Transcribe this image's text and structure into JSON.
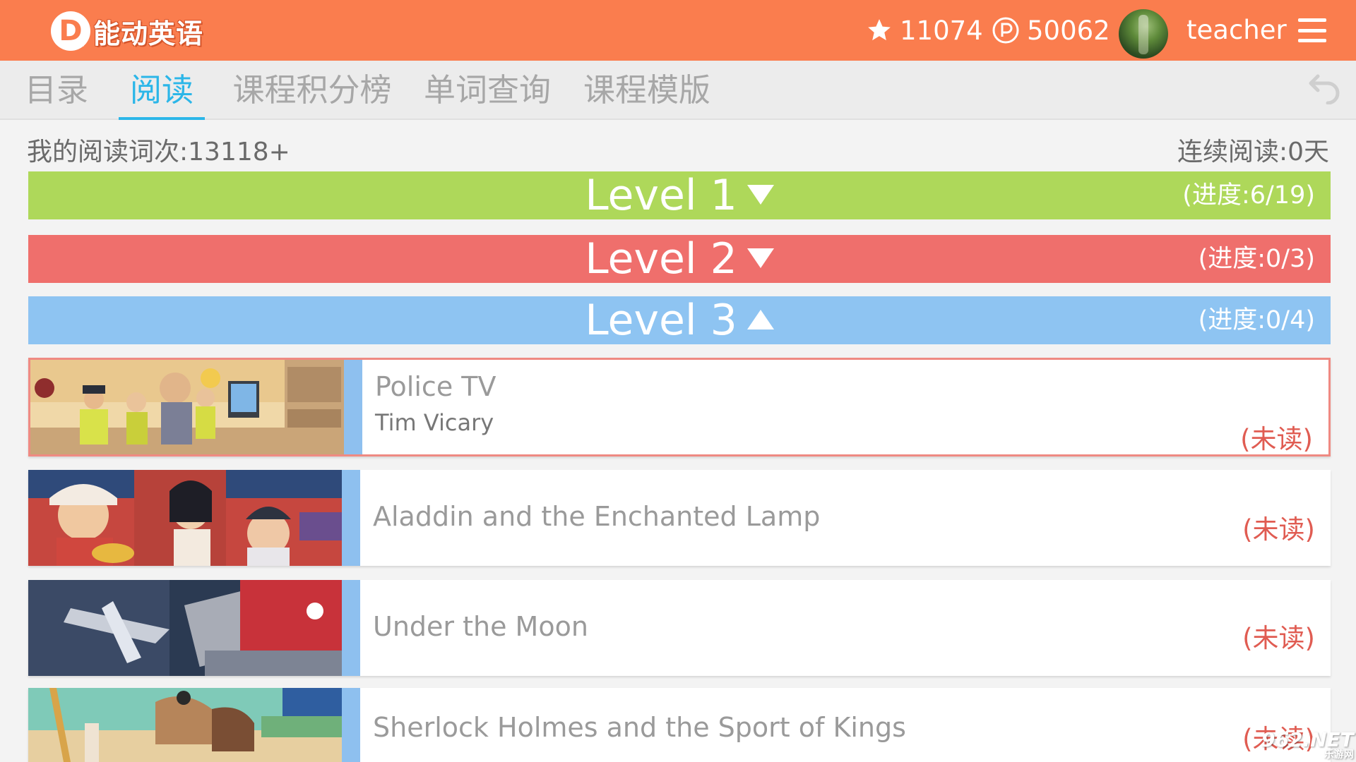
{
  "header": {
    "logo_letter": "D",
    "logo_text": "能动英语",
    "stars": "11074",
    "points": "50062",
    "username": "teacher",
    "icons": {
      "stars": "star-icon",
      "points": "points-coin-icon",
      "menu": "hamburger-menu-icon"
    }
  },
  "tabs": [
    {
      "label": "目录",
      "active": false
    },
    {
      "label": "阅读",
      "active": true
    },
    {
      "label": "课程积分榜",
      "active": false
    },
    {
      "label": "单词查询",
      "active": false
    },
    {
      "label": "课程模版",
      "active": false
    }
  ],
  "summary": {
    "read_count": "我的阅读词次:13118+",
    "streak": "连续阅读:0天"
  },
  "levels": [
    {
      "title": "Level 1",
      "expanded": false,
      "progress": "(进度:6/19)",
      "color": "#aed85a"
    },
    {
      "title": "Level 2",
      "expanded": false,
      "progress": "(进度:0/3)",
      "color": "#ef6f6c"
    },
    {
      "title": "Level 3",
      "expanded": true,
      "progress": "(进度:0/4)",
      "color": "#8ec4f2"
    }
  ],
  "books": [
    {
      "title": "Police TV",
      "author": "Tim Vicary",
      "status": "(未读)"
    },
    {
      "title": "Aladdin and the Enchanted Lamp",
      "author": "",
      "status": "(未读)"
    },
    {
      "title": "Under the Moon",
      "author": "",
      "status": "(未读)"
    },
    {
      "title": "Sherlock Holmes and the Sport of Kings",
      "author": "",
      "status": "(未读)"
    }
  ],
  "watermark": {
    "text": "962.NET",
    "sub": "乐游网"
  }
}
